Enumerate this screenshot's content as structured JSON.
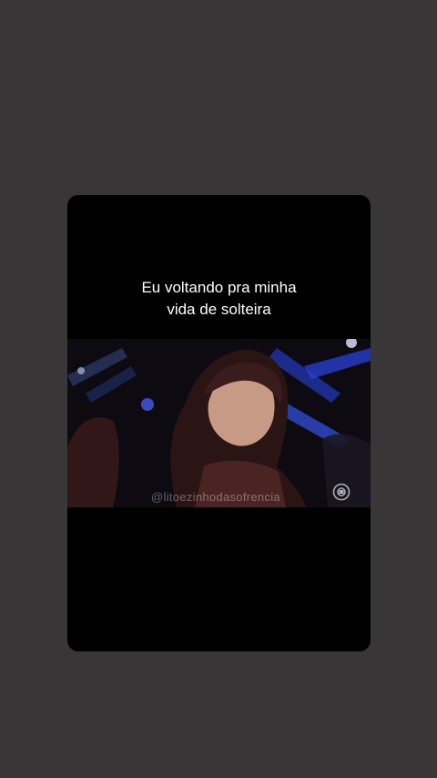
{
  "story": {
    "caption": "Eu voltando pra minha\nvida de solteira",
    "video": {
      "watermark": "@litoezinhodasofrencia",
      "logo_icon": "broadcaster-logo-icon"
    }
  },
  "colors": {
    "background": "#383636",
    "card": "#000000",
    "caption_text": "#ffffff",
    "accent_blue": "#2f4bff"
  }
}
